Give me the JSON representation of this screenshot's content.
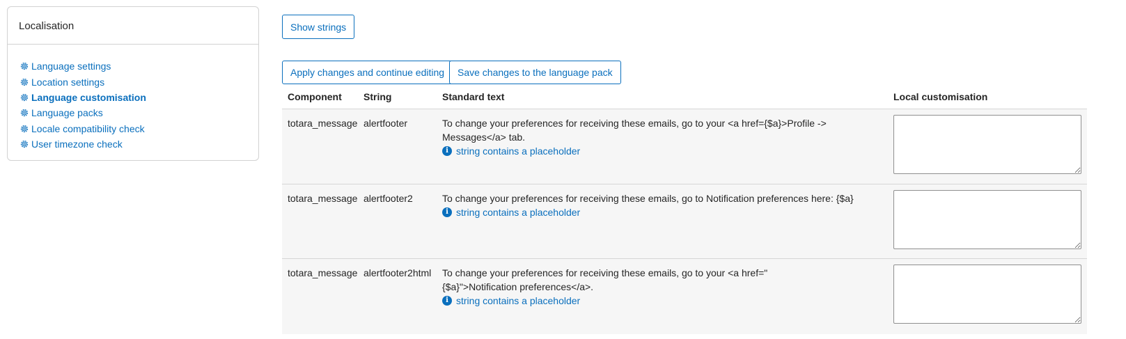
{
  "sidebar": {
    "title": "Localisation",
    "items": [
      {
        "label": "Language settings",
        "icon": "gear-icon"
      },
      {
        "label": "Location settings",
        "icon": "gear-icon"
      },
      {
        "label": "Language customisation",
        "icon": "gear-icon",
        "active": true
      },
      {
        "label": "Language packs",
        "icon": "gear-icon"
      },
      {
        "label": "Locale compatibility check",
        "icon": "gear-icon"
      },
      {
        "label": "User timezone check",
        "icon": "gear-icon"
      }
    ]
  },
  "toolbar": {
    "show_strings": "Show strings",
    "apply_changes": "Apply changes and continue editing",
    "save_changes": "Save changes to the language pack"
  },
  "table": {
    "headers": [
      "Component",
      "String",
      "Standard text",
      "Local customisation"
    ],
    "placeholder_hint": "string contains a placeholder",
    "rows": [
      {
        "component": "totara_message",
        "string": "alertfooter",
        "text": "To change your preferences for receiving these emails, go to your <a href={$a}>Profile -> Messages</a> tab.",
        "local": ""
      },
      {
        "component": "totara_message",
        "string": "alertfooter2",
        "text": "To change your preferences for receiving these emails, go to Notification preferences here: {$a}",
        "local": ""
      },
      {
        "component": "totara_message",
        "string": "alertfooter2html",
        "text": "To change your preferences for receiving these emails, go to your <a href=\"{$a}\">Notification preferences</a>.",
        "local": ""
      }
    ]
  },
  "colors": {
    "accent": "#0a6fbd",
    "row_bg": "#f6f6f6",
    "border": "#d2d2d2"
  }
}
